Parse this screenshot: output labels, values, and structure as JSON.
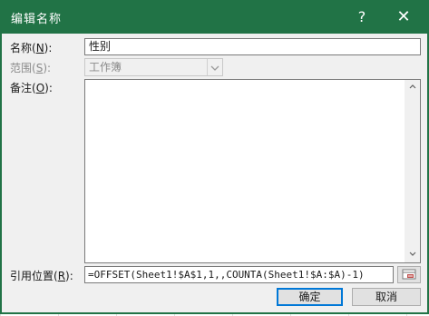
{
  "titlebar": {
    "title": "编辑名称",
    "help": "?",
    "close": "✕"
  },
  "form": {
    "name_label_pre": "名称(",
    "name_label_key": "N",
    "name_label_post": "):",
    "name_value": "性别",
    "scope_label_pre": "范围(",
    "scope_label_key": "S",
    "scope_label_post": "):",
    "scope_value": "工作簿",
    "comment_label_pre": "备注(",
    "comment_label_key": "O",
    "comment_label_post": "):",
    "comment_value": "",
    "ref_label_pre": "引用位置(",
    "ref_label_key": "R",
    "ref_label_post": "):",
    "ref_value": "=OFFSET(Sheet1!$A$1,1,,COUNTA(Sheet1!$A:$A)-1)"
  },
  "buttons": {
    "ok": "确定",
    "cancel": "取消"
  },
  "colors": {
    "titlebar": "#217346",
    "focus": "#0078d7"
  },
  "icons": {
    "range_picker": "range-select-icon"
  }
}
